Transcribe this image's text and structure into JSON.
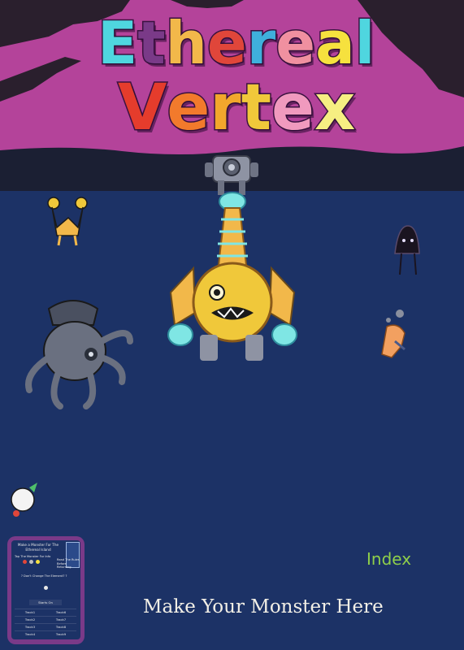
{
  "title": {
    "line1": [
      "E",
      "t",
      "h",
      "e",
      "r",
      "e",
      "a",
      "l"
    ],
    "line2": [
      "V",
      "e",
      "r",
      "t",
      "e",
      "x"
    ]
  },
  "colors": {
    "line1": [
      "#4fd6df",
      "#7a3a88",
      "#f2b84a",
      "#e0463a",
      "#3fb0dc",
      "#f090a0",
      "#f6e13e",
      "#4fd6df"
    ],
    "line2": [
      "#e53c2c",
      "#f27a2c",
      "#f2a72c",
      "#f0c83a",
      "#f09abe",
      "#f6ef82"
    ],
    "sky": "#b4439a",
    "ground": "#1c3266",
    "index": "#8fcf4a",
    "cta": "#f2efe6"
  },
  "panel": {
    "heading": "Make a Monster For The Ethereal Island",
    "tap_hint": "Tap The Monster For Info",
    "read_rules": "Read The Rules Before Returning",
    "change_prompt": "? Don't Change The Element? ?",
    "start_label": "Starts On",
    "tracks": [
      [
        "Track1",
        "Track6"
      ],
      [
        "Track2",
        "Track7"
      ],
      [
        "Track3",
        "Track8"
      ],
      [
        "Track4",
        "Track9"
      ]
    ]
  },
  "nav": {
    "index_label": "Index",
    "make_monster_label": "Make Your Monster Here"
  }
}
